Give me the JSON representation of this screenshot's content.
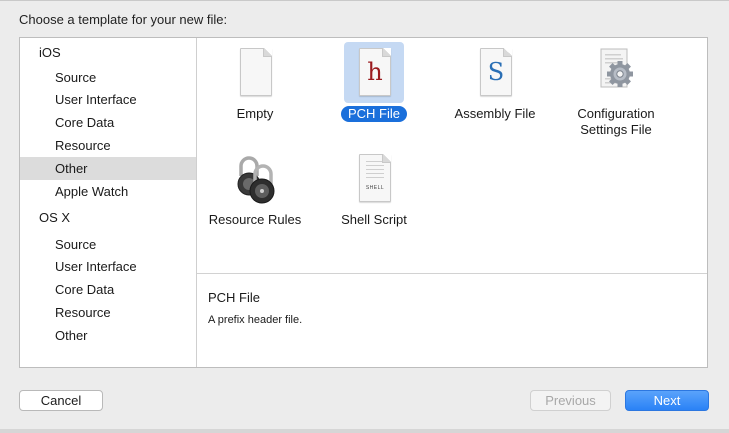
{
  "header": {
    "title": "Choose a template for your new file:"
  },
  "sidebar": {
    "groups": [
      {
        "label": "iOS",
        "items": [
          "Source",
          "User Interface",
          "Core Data",
          "Resource",
          "Other",
          "Apple Watch"
        ]
      },
      {
        "label": "OS X",
        "items": [
          "Source",
          "User Interface",
          "Core Data",
          "Resource",
          "Other"
        ]
      }
    ],
    "selected": "iOS / Other"
  },
  "templates": [
    {
      "label": "Empty",
      "icon": "empty-document-icon"
    },
    {
      "label": "PCH File",
      "icon": "pch-file-icon",
      "glyph": "h",
      "selected": true
    },
    {
      "label": "Assembly File",
      "icon": "assembly-file-icon",
      "glyph": "S"
    },
    {
      "label": "Configuration Settings File",
      "line1": "Configuration",
      "line2": "Settings File",
      "icon": "gear-document-icon"
    },
    {
      "label": "Resource Rules",
      "icon": "padlock-icon"
    },
    {
      "label": "Shell Script",
      "icon": "shell-script-icon",
      "tag": "SHELL"
    }
  ],
  "description": {
    "title": "PCH File",
    "text": "A prefix header file."
  },
  "buttons": {
    "cancel": "Cancel",
    "previous": "Previous",
    "next": "Next"
  },
  "colors": {
    "selection_blue": "#1a6fdb",
    "selection_tile": "#c5d9f3",
    "pch_glyph": "#9b1b1f",
    "assembly_glyph": "#2a6fb5"
  }
}
